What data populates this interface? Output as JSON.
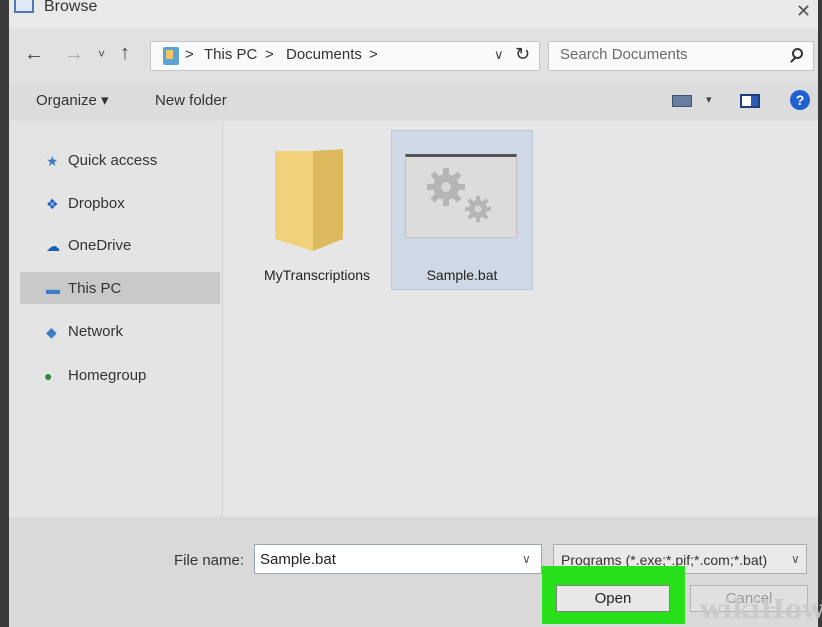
{
  "window": {
    "title": "Browse"
  },
  "address": {
    "separator": ">",
    "crumbs": [
      "This PC",
      "Documents"
    ],
    "dropdown_glyph": "∨",
    "refresh_glyph": "↻"
  },
  "nav_buttons": {
    "back": "←",
    "forward": "→",
    "recent": "˅",
    "up": "↑"
  },
  "search": {
    "placeholder": "Search Documents"
  },
  "toolbar": {
    "organize": "Organize ▾",
    "new_folder": "New folder",
    "help": "?"
  },
  "sidebar": {
    "items": [
      {
        "label": "Quick access",
        "icon": "star-icon",
        "glyph": "★",
        "color": "#3a78c9"
      },
      {
        "label": "Dropbox",
        "icon": "dropbox-icon",
        "glyph": "❖",
        "color": "#1a63c8"
      },
      {
        "label": "OneDrive",
        "icon": "cloud-icon",
        "glyph": "☁",
        "color": "#1d5fb8"
      },
      {
        "label": "This PC",
        "icon": "computer-icon",
        "glyph": "▬",
        "color": "#3c7fc9",
        "selected": true
      },
      {
        "label": "Network",
        "icon": "network-icon",
        "glyph": "◆",
        "color": "#3d7ec4"
      },
      {
        "label": "Homegroup",
        "icon": "homegroup-icon",
        "glyph": "●",
        "color": "#2d8a3a"
      }
    ]
  },
  "files": [
    {
      "name": "MyTranscriptions",
      "icon": "folder-icon"
    },
    {
      "name": "Sample.bat",
      "icon": "batch-file-icon",
      "selected": true
    }
  ],
  "footer": {
    "filename_label": "File name:",
    "filename_value": "Sample.bat",
    "filetype_value": "Programs (*.exe;*.pif;*.com;*.bat)",
    "open": "Open",
    "cancel": "Cancel",
    "watermark": "wikiHow"
  },
  "colors": {
    "highlight": "#27e01a",
    "selection": "#cfd9e5"
  }
}
